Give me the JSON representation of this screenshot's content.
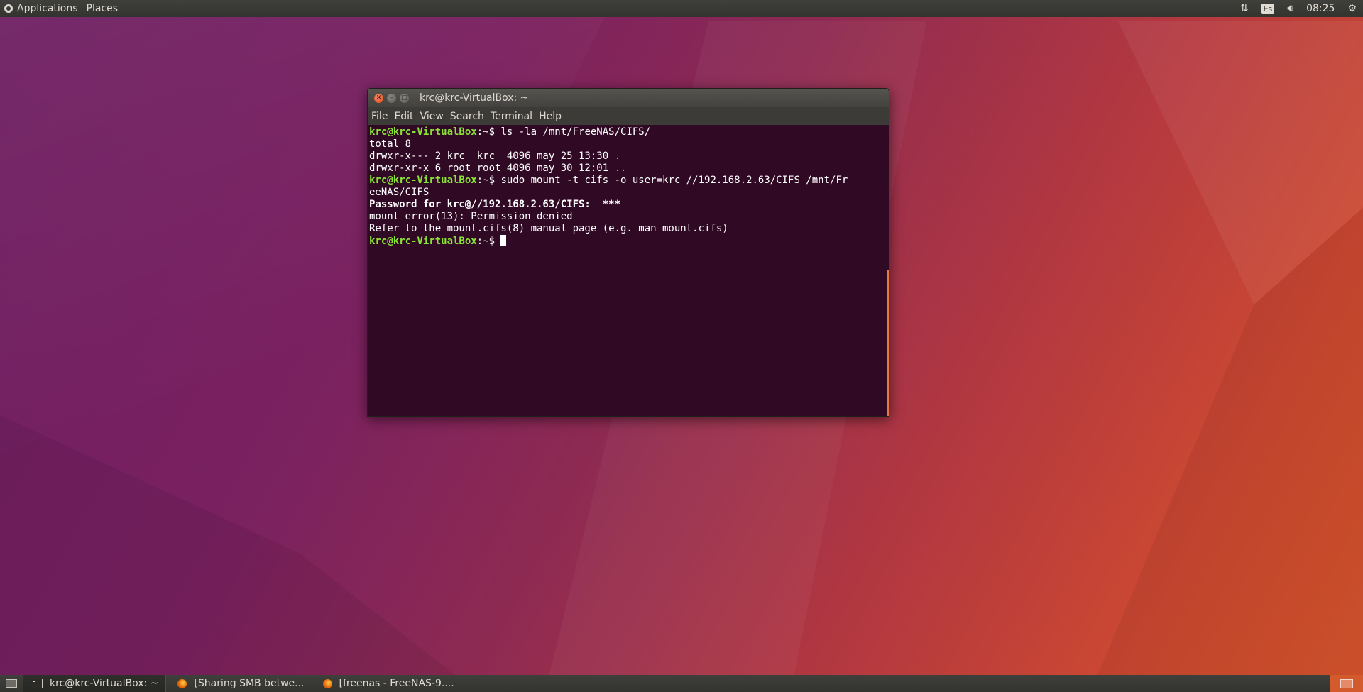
{
  "top_panel": {
    "applications_label": "Applications",
    "places_label": "Places",
    "keyboard_layout": "Es",
    "clock": "08:25",
    "network_icon": "network-transfer-icon",
    "volume_icon": "volume-icon",
    "settings_icon": "gear-icon"
  },
  "terminal": {
    "title": "krc@krc-VirtualBox: ~",
    "menu": [
      "File",
      "Edit",
      "View",
      "Search",
      "Terminal",
      "Help"
    ],
    "prompt_user": "krc@krc-VirtualBox",
    "prompt_suffix": ":~$ ",
    "lines": {
      "cmd1": "ls -la /mnt/FreeNAS/CIFS/",
      "out1": "total 8",
      "out2_text": "drwxr-x--- 2 krc  krc  4096 may 25 13:30 ",
      "out2_dir": ".",
      "out3_text": "drwxr-xr-x 6 root root 4096 may 30 12:01 ",
      "out3_dir": "..",
      "cmd2": "sudo mount -t cifs -o user=krc //192.168.2.63/CIFS /mnt/Fr",
      "cmd2_wrap": "eeNAS/CIFS",
      "password_prompt": "Password for krc@//192.168.2.63/CIFS:  ***",
      "error": "mount error(13): Permission denied",
      "hint": "Refer to the mount.cifs(8) manual page (e.g. man mount.cifs)"
    },
    "colors": {
      "background": "#300a24",
      "prompt": "#8ae234",
      "directory": "#729fcf"
    }
  },
  "taskbar": {
    "tasks": [
      {
        "label": "krc@krc-VirtualBox: ~",
        "icon": "terminal-icon"
      },
      {
        "label": "[Sharing SMB betwe...",
        "icon": "firefox-icon"
      },
      {
        "label": "[freenas - FreeNAS-9....",
        "icon": "firefox-icon"
      }
    ]
  }
}
